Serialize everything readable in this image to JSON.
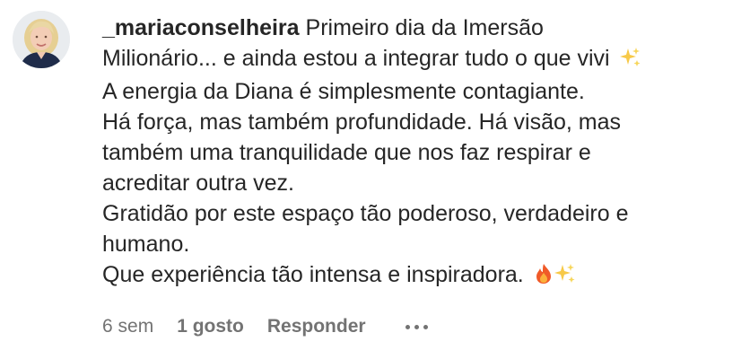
{
  "comment": {
    "username": "_mariaconselheira",
    "first_line_text": "Primeiro dia da Imersão",
    "lines": [
      "Milionário... e ainda estou a integrar tudo o que vivi",
      "A energia da Diana é simplesmente contagiante.",
      "Há força, mas também profundidade. Há visão, mas",
      "também uma tranquilidade que nos faz respirar e",
      "acreditar outra vez.",
      "Gratidão por este espaço tão poderoso, verdadeiro e",
      "humano.",
      "Que experiência tão intensa e inspiradora."
    ],
    "icons": [
      "sparkles-emoji",
      "fire-emoji",
      "sparkles-emoji"
    ]
  },
  "meta": {
    "age": "6 sem",
    "likes": "1 gosto",
    "reply": "Responder",
    "more_icon": "more-options-icon"
  },
  "colors": {
    "text": "#262626",
    "secondary": "#737373",
    "background": "#ffffff"
  }
}
